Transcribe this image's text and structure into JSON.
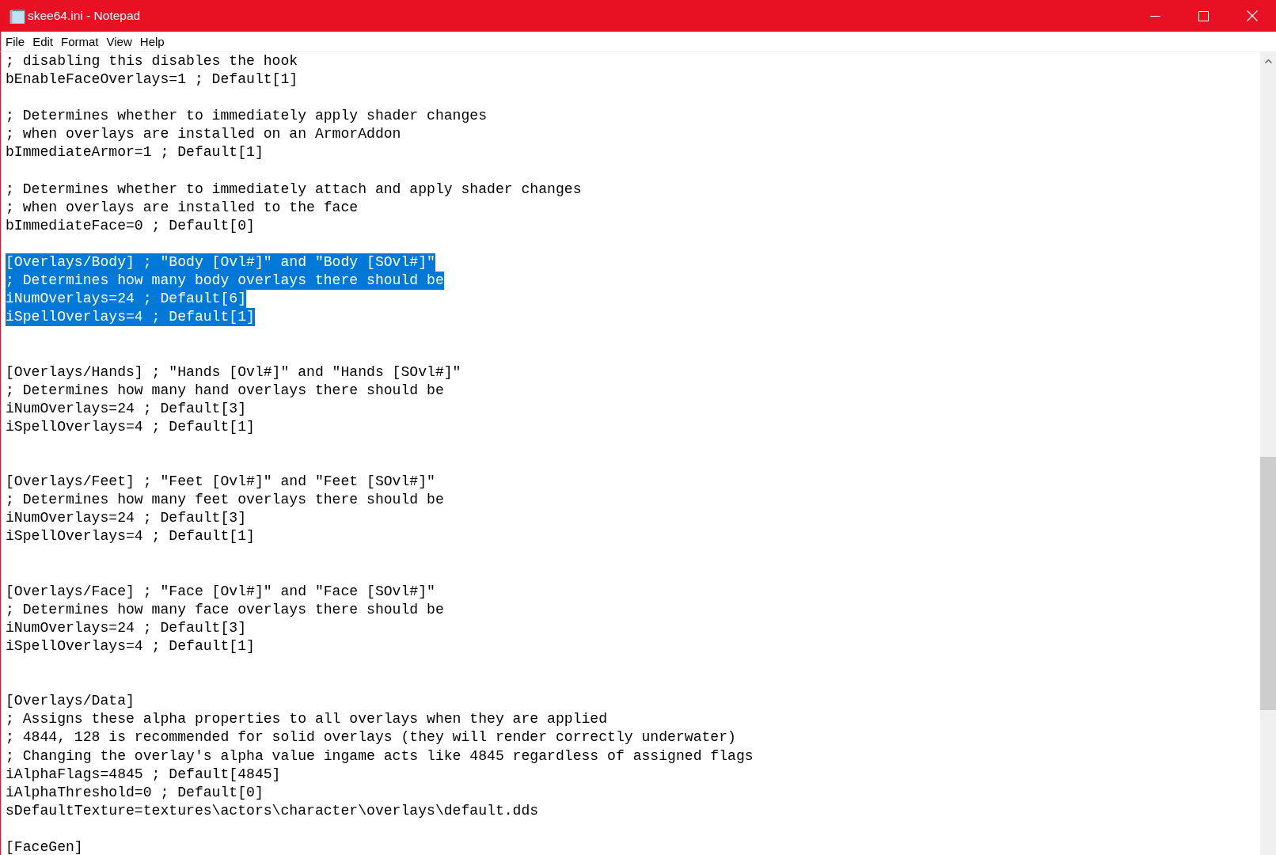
{
  "window": {
    "title": "skee64.ini - Notepad"
  },
  "menu": [
    {
      "label": "File"
    },
    {
      "label": "Edit"
    },
    {
      "label": "Format"
    },
    {
      "label": "View"
    },
    {
      "label": "Help"
    }
  ],
  "document": {
    "lines": [
      {
        "kind": "text",
        "text": "; disabling this disables the hook",
        "selected": false
      },
      {
        "kind": "text",
        "text": "bEnableFaceOverlays=1 ; Default[1]",
        "selected": false
      },
      {
        "kind": "blank"
      },
      {
        "kind": "text",
        "text": "; Determines whether to immediately apply shader changes",
        "selected": false
      },
      {
        "kind": "text",
        "text": "; when overlays are installed on an ArmorAddon",
        "selected": false
      },
      {
        "kind": "text",
        "text": "bImmediateArmor=1 ; Default[1]",
        "selected": false
      },
      {
        "kind": "blank"
      },
      {
        "kind": "text",
        "text": "; Determines whether to immediately attach and apply shader changes",
        "selected": false
      },
      {
        "kind": "text",
        "text": "; when overlays are installed to the face",
        "selected": false
      },
      {
        "kind": "text",
        "text": "bImmediateFace=0 ; Default[0]",
        "selected": false
      },
      {
        "kind": "blank"
      },
      {
        "kind": "text",
        "text": "[Overlays/Body] ; \"Body [Ovl#]\" and \"Body [SOvl#]\"",
        "selected": true
      },
      {
        "kind": "text",
        "text": "; Determines how many body overlays there should be",
        "selected": true
      },
      {
        "kind": "text",
        "text": "iNumOverlays=24 ; Default[6]",
        "selected": true
      },
      {
        "kind": "text",
        "text": "iSpellOverlays=4 ; Default[1]",
        "selected": true
      },
      {
        "kind": "blank"
      },
      {
        "kind": "blank"
      },
      {
        "kind": "text",
        "text": "[Overlays/Hands] ; \"Hands [Ovl#]\" and \"Hands [SOvl#]\"",
        "selected": false
      },
      {
        "kind": "text",
        "text": "; Determines how many hand overlays there should be",
        "selected": false
      },
      {
        "kind": "text",
        "text": "iNumOverlays=24 ; Default[3]",
        "selected": false
      },
      {
        "kind": "text",
        "text": "iSpellOverlays=4 ; Default[1]",
        "selected": false
      },
      {
        "kind": "blank"
      },
      {
        "kind": "blank"
      },
      {
        "kind": "text",
        "text": "[Overlays/Feet] ; \"Feet [Ovl#]\" and \"Feet [SOvl#]\"",
        "selected": false
      },
      {
        "kind": "text",
        "text": "; Determines how many feet overlays there should be",
        "selected": false
      },
      {
        "kind": "text",
        "text": "iNumOverlays=24 ; Default[3]",
        "selected": false
      },
      {
        "kind": "text",
        "text": "iSpellOverlays=4 ; Default[1]",
        "selected": false
      },
      {
        "kind": "blank"
      },
      {
        "kind": "blank"
      },
      {
        "kind": "text",
        "text": "[Overlays/Face] ; \"Face [Ovl#]\" and \"Face [SOvl#]\"",
        "selected": false
      },
      {
        "kind": "text",
        "text": "; Determines how many face overlays there should be",
        "selected": false
      },
      {
        "kind": "text",
        "text": "iNumOverlays=24 ; Default[3]",
        "selected": false
      },
      {
        "kind": "text",
        "text": "iSpellOverlays=4 ; Default[1]",
        "selected": false
      },
      {
        "kind": "blank"
      },
      {
        "kind": "blank"
      },
      {
        "kind": "text",
        "text": "[Overlays/Data]",
        "selected": false
      },
      {
        "kind": "text",
        "text": "; Assigns these alpha properties to all overlays when they are applied",
        "selected": false
      },
      {
        "kind": "text",
        "text": "; 4844, 128 is recommended for solid overlays (they will render correctly underwater)",
        "selected": false
      },
      {
        "kind": "text",
        "text": "; Changing the overlay's alpha value ingame acts like 4845 regardless of assigned flags",
        "selected": false
      },
      {
        "kind": "text",
        "text": "iAlphaFlags=4845 ; Default[4845]",
        "selected": false
      },
      {
        "kind": "text",
        "text": "iAlphaThreshold=0 ; Default[0]",
        "selected": false
      },
      {
        "kind": "text",
        "text": "sDefaultTexture=textures\\actors\\character\\overlays\\default.dds",
        "selected": false
      },
      {
        "kind": "blank"
      },
      {
        "kind": "text",
        "text": "[FaceGen]",
        "selected": false
      }
    ]
  }
}
